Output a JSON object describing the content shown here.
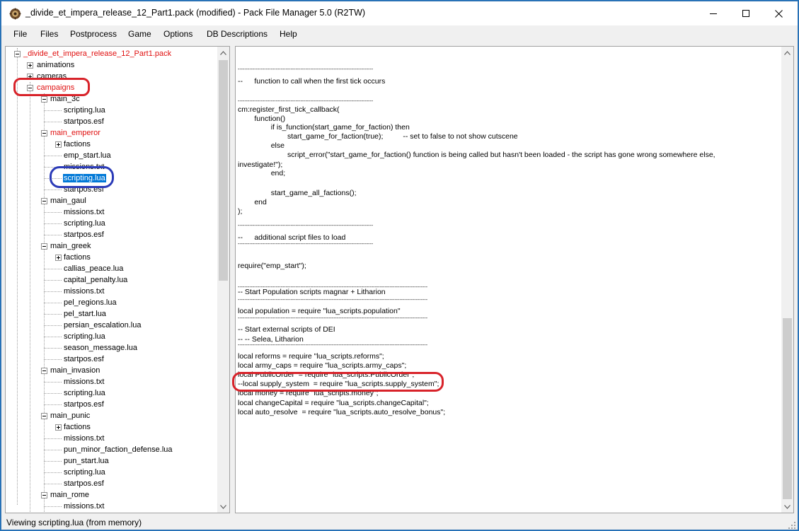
{
  "window": {
    "title": "_divide_et_impera_release_12_Part1.pack (modified) - Pack File Manager 5.0 (R2TW)"
  },
  "menu": [
    "File",
    "Files",
    "Postprocess",
    "Game",
    "Options",
    "DB Descriptions",
    "Help"
  ],
  "tree": {
    "root": "_divide_et_impera_release_12_Part1.pack",
    "nodes": [
      {
        "label": "animations",
        "expander": "plus"
      },
      {
        "label": "cameras",
        "expander": "plus"
      },
      {
        "label": "campaigns",
        "expander": "minus",
        "modified": true
      },
      {
        "label": "main_3c",
        "expander": "minus"
      },
      {
        "label": "scripting.lua"
      },
      {
        "label": "startpos.esf"
      },
      {
        "label": "main_emperor",
        "expander": "minus",
        "modified": true
      },
      {
        "label": "factions",
        "expander": "plus"
      },
      {
        "label": "emp_start.lua"
      },
      {
        "label": "missions.txt"
      },
      {
        "label": "scripting.lua",
        "selected": true
      },
      {
        "label": "startpos.esf"
      },
      {
        "label": "main_gaul",
        "expander": "minus"
      },
      {
        "label": "missions.txt"
      },
      {
        "label": "scripting.lua"
      },
      {
        "label": "startpos.esf"
      },
      {
        "label": "main_greek",
        "expander": "minus"
      },
      {
        "label": "factions",
        "expander": "plus"
      },
      {
        "label": "callias_peace.lua"
      },
      {
        "label": "capital_penalty.lua"
      },
      {
        "label": "missions.txt"
      },
      {
        "label": "pel_regions.lua"
      },
      {
        "label": "pel_start.lua"
      },
      {
        "label": "persian_escalation.lua"
      },
      {
        "label": "scripting.lua"
      },
      {
        "label": "season_message.lua"
      },
      {
        "label": "startpos.esf"
      },
      {
        "label": "main_invasion",
        "expander": "minus"
      },
      {
        "label": "missions.txt"
      },
      {
        "label": "scripting.lua"
      },
      {
        "label": "startpos.esf"
      },
      {
        "label": "main_punic",
        "expander": "minus"
      },
      {
        "label": "factions",
        "expander": "plus"
      },
      {
        "label": "missions.txt"
      },
      {
        "label": "pun_minor_faction_defense.lua"
      },
      {
        "label": "pun_start.lua"
      },
      {
        "label": "scripting.lua"
      },
      {
        "label": "startpos.esf"
      },
      {
        "label": "main_rome",
        "expander": "minus"
      },
      {
        "label": "missions.txt"
      }
    ]
  },
  "code_lines": [
    "----------------------------------------------------------------------------------",
    "--\t\tfunction to call when the first tick occurs",
    "----------------------------------------------------------------------------------",
    "",
    "cm:register_first_tick_callback(",
    "\t\tfunction()",
    "\t\t\t\tif is_function(start_game_for_faction) then",
    "\t\t\t\t\t\tstart_game_for_faction(true);\t\t\t-- set to false to not show cutscene",
    "\t\t\t\telse",
    "\t\t\t\t\t\tscript_error(\"start_game_for_faction() function is being called but hasn't been loaded - the script has gone wrong somewhere else,",
    "investigate!\");",
    "\t\t\t\tend;",
    "",
    "\t\t\t\tstart_game_all_factions();",
    "\t\tend",
    ");",
    "",
    "----------------------------------------------------------------------------------",
    "--\t\tadditional script files to load",
    "----------------------------------------------------------------------------------",
    "",
    "require(\"emp_start\");",
    "",
    "-------------------------------------------------------------------------------------------------------------------",
    "-- Start Population scripts magnar + Litharion",
    "-------------------------------------------------------------------------------------------------------------------",
    "local population = require \"lua_scripts.population\"",
    "-------------------------------------------------------------------------------------------------------------------",
    "-- Start external scripts of DEI",
    "-- -- Selea, Litharion",
    "-------------------------------------------------------------------------------------------------------------------",
    "local reforms = require \"lua_scripts.reforms\";",
    "local army_caps = require \"lua_scripts.army_caps\";",
    "local PublicOrder  = require \"lua_scripts.PublicOrder\";",
    "--local supply_system  = require \"lua_scripts.supply_system\";",
    "local money = require \"lua_scripts.money\";",
    "local changeCapital = require \"lua_scripts.changeCapital\";",
    "local auto_resolve  = require \"lua_scripts.auto_resolve_bonus\";"
  ],
  "status": {
    "text": "Viewing scripting.lua (from memory)"
  },
  "colors": {
    "modified": "#e01010",
    "selection": "#0078d7",
    "annotation_red": "#d8232a",
    "annotation_blue": "#2b3bb8"
  },
  "icons": [
    "app-icon",
    "minimize-icon",
    "maximize-icon",
    "close-icon",
    "scroll-up-icon",
    "scroll-down-icon"
  ]
}
